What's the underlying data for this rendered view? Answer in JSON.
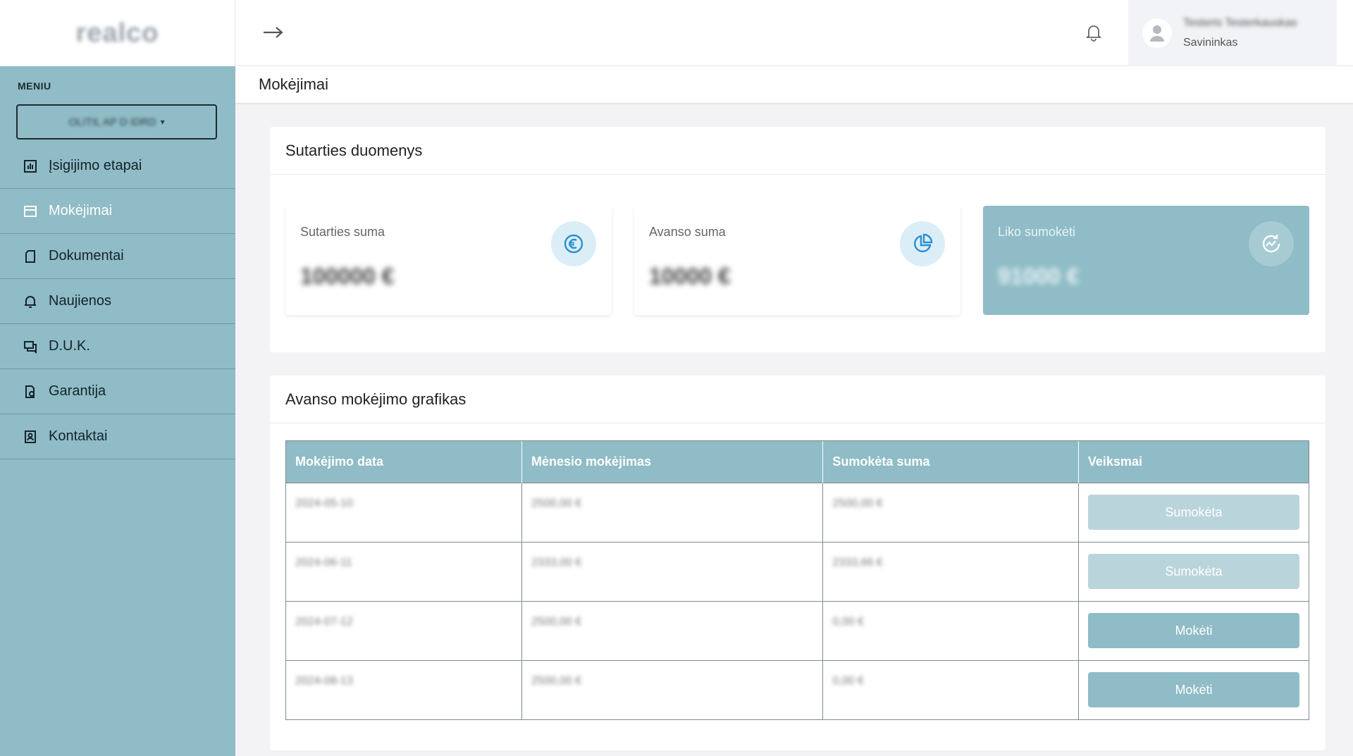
{
  "sidebar": {
    "logo": "realco",
    "menu_label": "MENIU",
    "project_select": "OLITIL AP D IDRD",
    "items": [
      {
        "label": "Įsigijimo etapai",
        "icon": "bar-chart-icon",
        "active": false
      },
      {
        "label": "Mokėjimai",
        "icon": "credit-card-icon",
        "active": true
      },
      {
        "label": "Dokumentai",
        "icon": "document-icon",
        "active": false
      },
      {
        "label": "Naujienos",
        "icon": "bell-icon",
        "active": false
      },
      {
        "label": "D.U.K.",
        "icon": "chat-icon",
        "active": false
      },
      {
        "label": "Garantija",
        "icon": "warranty-icon",
        "active": false
      },
      {
        "label": "Kontaktai",
        "icon": "contact-icon",
        "active": false
      }
    ]
  },
  "header": {
    "user_name": "Testeris Testerkauskas",
    "user_role": "Savininkas"
  },
  "page": {
    "title": "Mokėjimai"
  },
  "contract": {
    "title": "Sutarties duomenys",
    "stats": [
      {
        "label": "Sutarties suma",
        "value": "100000 €",
        "icon": "euro-icon"
      },
      {
        "label": "Avanso suma",
        "value": "10000 €",
        "icon": "pie-chart-icon"
      },
      {
        "label": "Liko sumokėti",
        "value": "91000 €",
        "icon": "refresh-chart-icon"
      }
    ]
  },
  "schedule": {
    "title": "Avanso mokėjimo grafikas",
    "columns": [
      "Mokėjimo data",
      "Mėnesio mokėjimas",
      "Sumokėta suma",
      "Veiksmai"
    ],
    "rows": [
      {
        "date": "2024-05-10",
        "monthly": "2500,00 €",
        "paid": "2500,00 €",
        "action": "Sumokėta",
        "state": "paid"
      },
      {
        "date": "2024-06-11",
        "monthly": "2333,00 €",
        "paid": "2333,66 €",
        "action": "Sumokėta",
        "state": "paid"
      },
      {
        "date": "2024-07-12",
        "monthly": "2500,00 €",
        "paid": "0,00 €",
        "action": "Mokėti",
        "state": "pay"
      },
      {
        "date": "2024-08-13",
        "monthly": "2500,00 €",
        "paid": "0,00 €",
        "action": "Mokėti",
        "state": "pay"
      }
    ]
  },
  "colors": {
    "accent": "#8fbcc6",
    "accent_light": "#b9d5db",
    "icon_blue": "#2a8fd0"
  }
}
